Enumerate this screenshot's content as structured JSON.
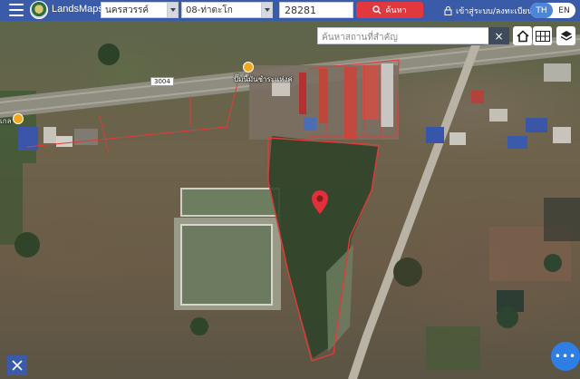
{
  "app": {
    "brand": "LandsMaps",
    "province": "นครสวรรค์",
    "district": "08-ท่าตะโก",
    "parcel_number": "28281",
    "search_button": "ค้นหา",
    "login_label": "เข้าสู่ระบบ/ลงทะเบียน",
    "lang_th": "TH",
    "lang_en": "EN"
  },
  "map": {
    "place_search_placeholder": "ค้นหาสถานที่สำคัญ",
    "close_label": "×",
    "road_shield": "3004",
    "poi_gas_station": "ปั๊มนี้มันชำระแห่งค่",
    "poi_left": "เกล",
    "fab_label": "•••",
    "pin_color": "#e0303a",
    "parcel_outline_color": "#e23a3a"
  }
}
